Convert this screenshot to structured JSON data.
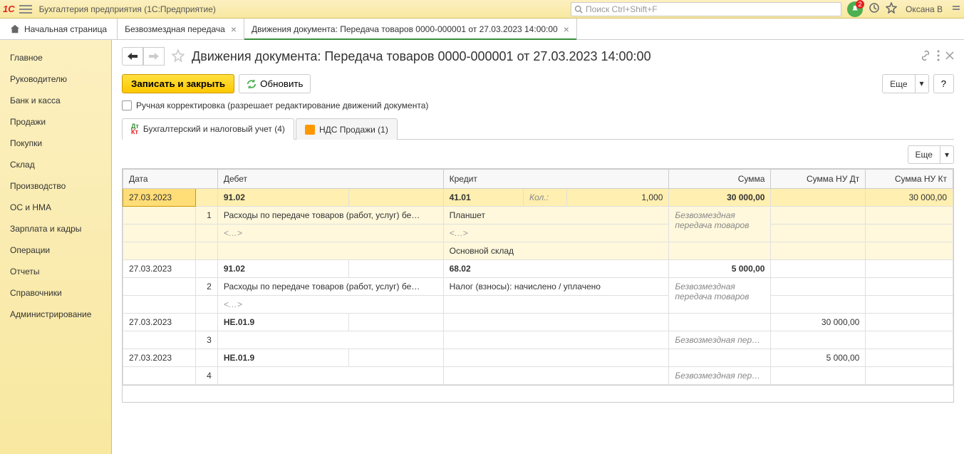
{
  "app": {
    "title": "Бухгалтерия предприятия  (1С:Предприятие)",
    "search_placeholder": "Поиск Ctrl+Shift+F",
    "notification_count": "2",
    "user": "Оксана В"
  },
  "tabs": {
    "home": "Начальная страница",
    "items": [
      {
        "label": "Безвозмездная передача"
      },
      {
        "label": "Движения документа: Передача товаров 0000-000001 от 27.03.2023 14:00:00"
      }
    ]
  },
  "sidebar": {
    "items": [
      {
        "label": "Главное"
      },
      {
        "label": "Руководителю"
      },
      {
        "label": "Банк и касса"
      },
      {
        "label": "Продажи"
      },
      {
        "label": "Покупки"
      },
      {
        "label": "Склад"
      },
      {
        "label": "Производство"
      },
      {
        "label": "ОС и НМА"
      },
      {
        "label": "Зарплата и кадры"
      },
      {
        "label": "Операции"
      },
      {
        "label": "Отчеты"
      },
      {
        "label": "Справочники"
      },
      {
        "label": "Администрирование"
      }
    ]
  },
  "page": {
    "title": "Движения документа: Передача товаров 0000-000001 от 27.03.2023 14:00:00"
  },
  "toolbar": {
    "save_close": "Записать и закрыть",
    "refresh": "Обновить",
    "more": "Еще",
    "help": "?"
  },
  "checkbox": {
    "manual_label": "Ручная корректировка (разрешает редактирование движений документа)"
  },
  "inner_tabs": [
    {
      "label": "Бухгалтерский и налоговый учет (4)"
    },
    {
      "label": "НДС Продажи (1)"
    }
  ],
  "table": {
    "headers": {
      "date": "Дата",
      "debit": "Дебет",
      "credit": "Кредит",
      "sum": "Сумма",
      "nu_dt": "Сумма НУ Дт",
      "nu_kt": "Сумма НУ Кт"
    },
    "rows": [
      {
        "date": "27.03.2023",
        "num": "1",
        "debit_acc": "91.02",
        "credit_acc": "41.01",
        "qty_label": "Кол.:",
        "qty": "1,000",
        "sum": "30 000,00",
        "nu_kt": "30 000,00",
        "debit_desc": "Расходы по передаче товаров (работ, услуг) бе…",
        "credit_desc": "Планшет",
        "sum_desc": "Безвозмездная передача товаров",
        "debit_sub": "<…>",
        "credit_sub": "<…>",
        "credit_sub2": "Основной склад"
      },
      {
        "date": "27.03.2023",
        "num": "2",
        "debit_acc": "91.02",
        "credit_acc": "68.02",
        "sum": "5 000,00",
        "debit_desc": "Расходы по передаче товаров (работ, услуг) бе…",
        "credit_desc": "Налог (взносы): начислено / уплачено",
        "sum_desc": "Безвозмездная передача товаров",
        "debit_sub": "<…>"
      },
      {
        "date": "27.03.2023",
        "num": "3",
        "debit_acc": "НЕ.01.9",
        "nu_dt": "30 000,00",
        "sum_desc": "Безвозмездная пер…"
      },
      {
        "date": "27.03.2023",
        "num": "4",
        "debit_acc": "НЕ.01.9",
        "nu_dt": "5 000,00",
        "sum_desc": "Безвозмездная пер…"
      }
    ]
  }
}
